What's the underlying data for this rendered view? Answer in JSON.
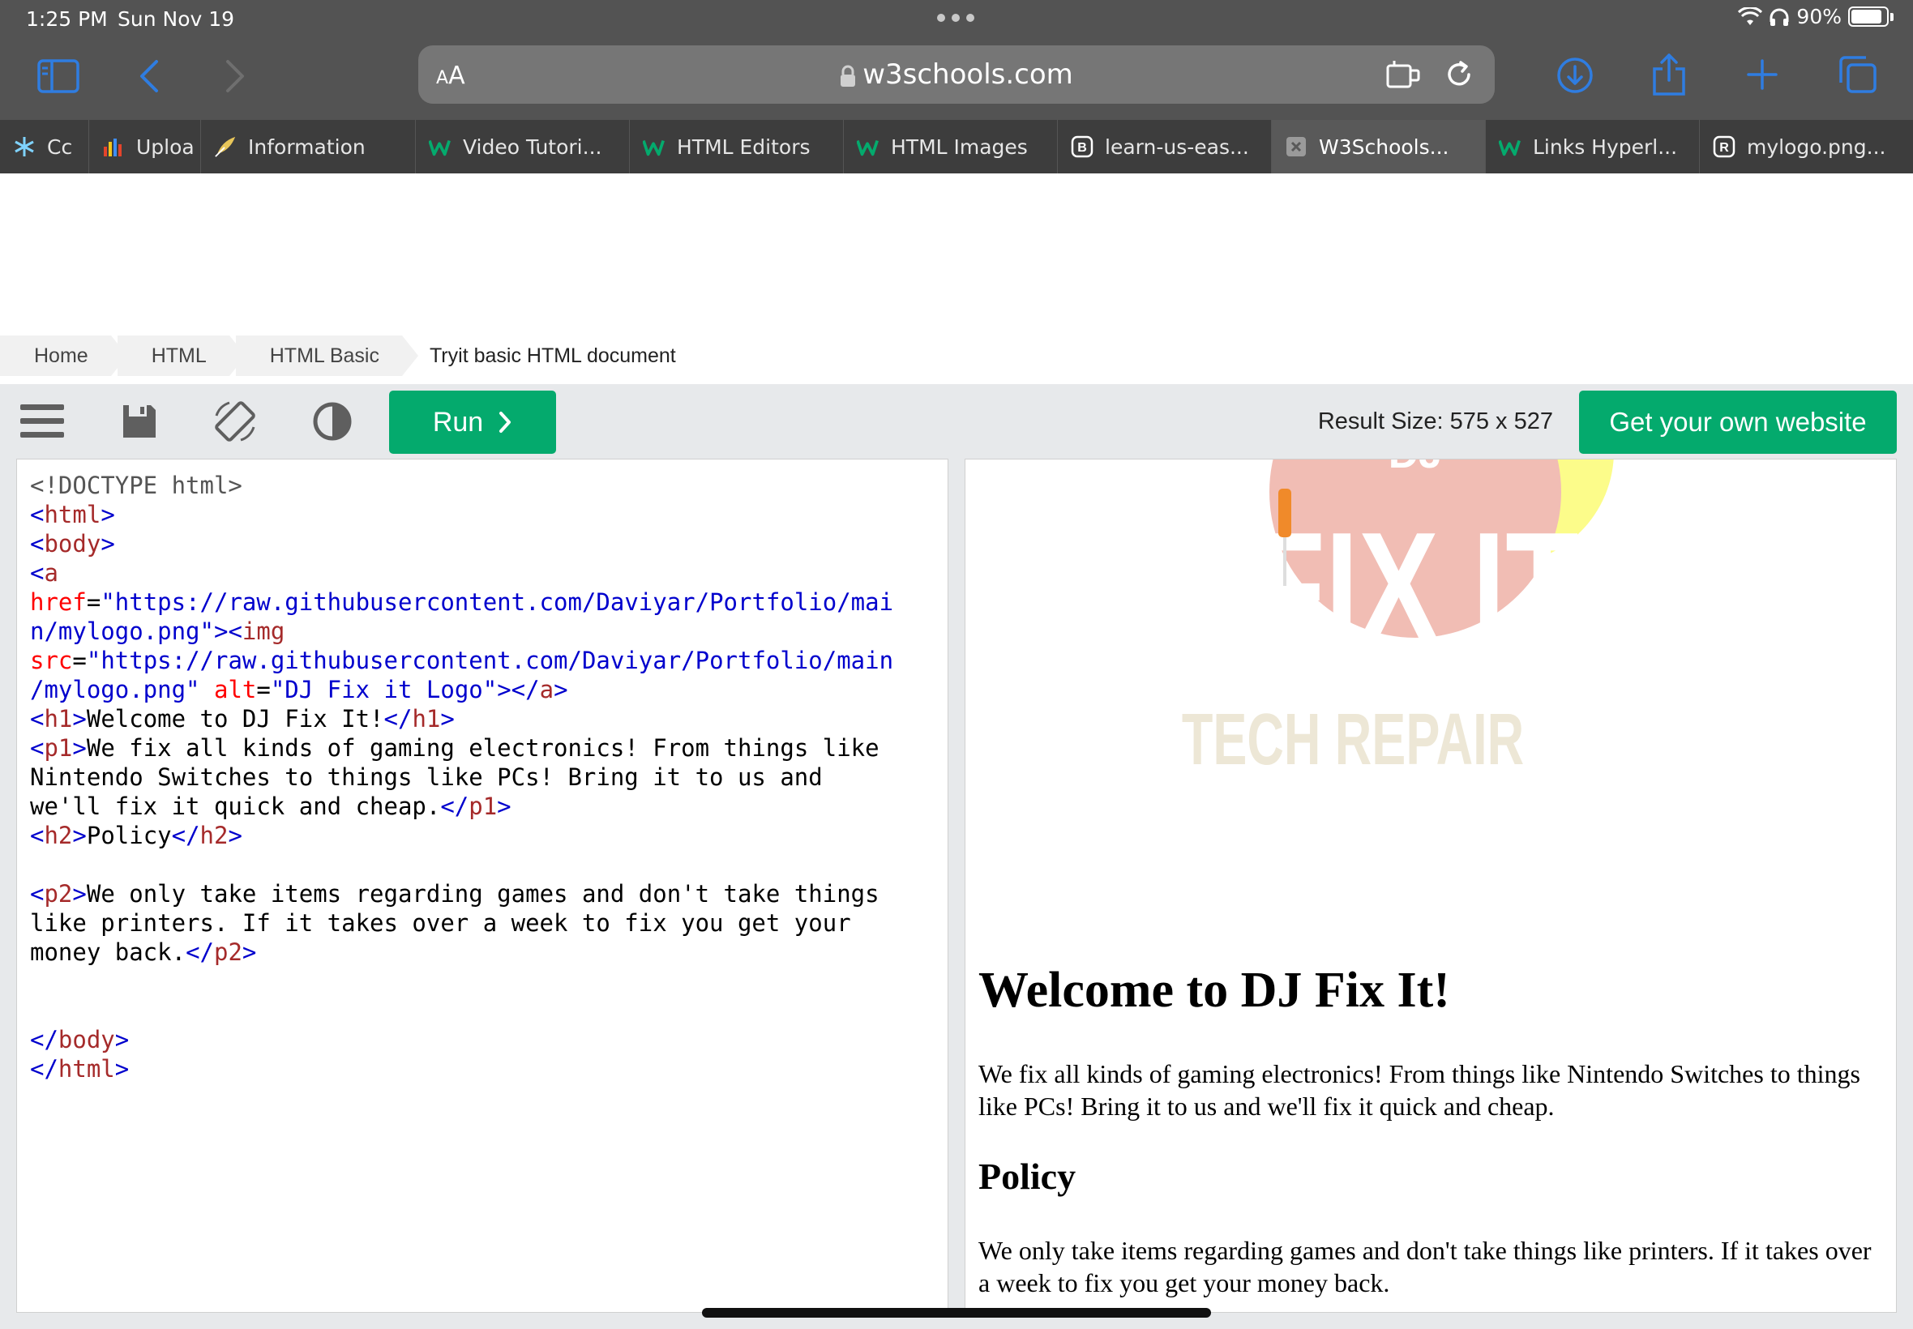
{
  "status": {
    "time": "1:25 PM",
    "date": "Sun Nov 19",
    "battery": "90%"
  },
  "address_bar": {
    "aa_label": "A",
    "aa_label_small": "A",
    "url": "w3schools.com"
  },
  "tabs": [
    {
      "label": "Cc",
      "icon": "snowflake-icon",
      "active": false
    },
    {
      "label": "Uploa",
      "icon": "bar-chart-icon",
      "active": false
    },
    {
      "label": "Information",
      "icon": "feather-icon",
      "active": false
    },
    {
      "label": "Video Tutori...",
      "icon": "w3schools-icon",
      "active": false
    },
    {
      "label": "HTML Editors",
      "icon": "w3schools-icon",
      "active": false
    },
    {
      "label": "HTML Images",
      "icon": "w3schools-icon",
      "active": false
    },
    {
      "label": "learn-us-eas...",
      "icon": "letter-b-icon",
      "active": false
    },
    {
      "label": "W3Schools...",
      "icon": "close-icon",
      "active": true
    },
    {
      "label": "Links Hyperl...",
      "icon": "w3schools-icon",
      "active": false
    },
    {
      "label": "mylogo.png...",
      "icon": "letter-r-icon",
      "active": false
    }
  ],
  "breadcrumb": {
    "items": [
      "Home",
      "HTML",
      "HTML Basic"
    ],
    "current": "Tryit basic HTML document"
  },
  "tryit": {
    "run_label": "Run",
    "result_size": "Result Size: 575 x 527",
    "own_website": "Get your own website"
  },
  "code": {
    "doctype": "<!DOCTYPE html>",
    "href_url": "\"https://raw.githubusercontent.com/Daviyar/Portfolio/mai",
    "href_url_2": "n/mylogo.png\"",
    "src_url": "\"https://raw.githubusercontent.com/Daviyar/Portfolio/main",
    "src_url_2": "/mylogo.png\"",
    "alt_val": "\"DJ Fix it Logo\"",
    "h1_text": "Welcome to DJ Fix It!",
    "p1_line1": "We fix all kinds of gaming electronics! From things like",
    "p1_line2": "Nintendo Switches to things like PCs! Bring it to us and",
    "p1_line3": "we'll fix it quick and cheap.",
    "h2_text": "Policy",
    "p2_line1": "We only take items regarding games and don't take things",
    "p2_line2": "like printers. If it takes over a week to fix you get your",
    "p2_line3": "money back."
  },
  "result": {
    "logo_main": "FIX IT",
    "logo_sub": "TECH REPAIR",
    "logo_top": "DJ",
    "h1": "Welcome to DJ Fix It!",
    "p1": "We fix all kinds of gaming electronics! From things like Nintendo Switches to things like PCs! Bring it to us and we'll fix it quick and cheap.",
    "h2": "Policy",
    "p2": "We only take items regarding games and don't take things like printers. If it takes over a week to fix you get your money back."
  },
  "colors": {
    "run_green": "#04aa6d",
    "chrome_gray": "#535353",
    "accent_blue": "#2f7de1"
  }
}
